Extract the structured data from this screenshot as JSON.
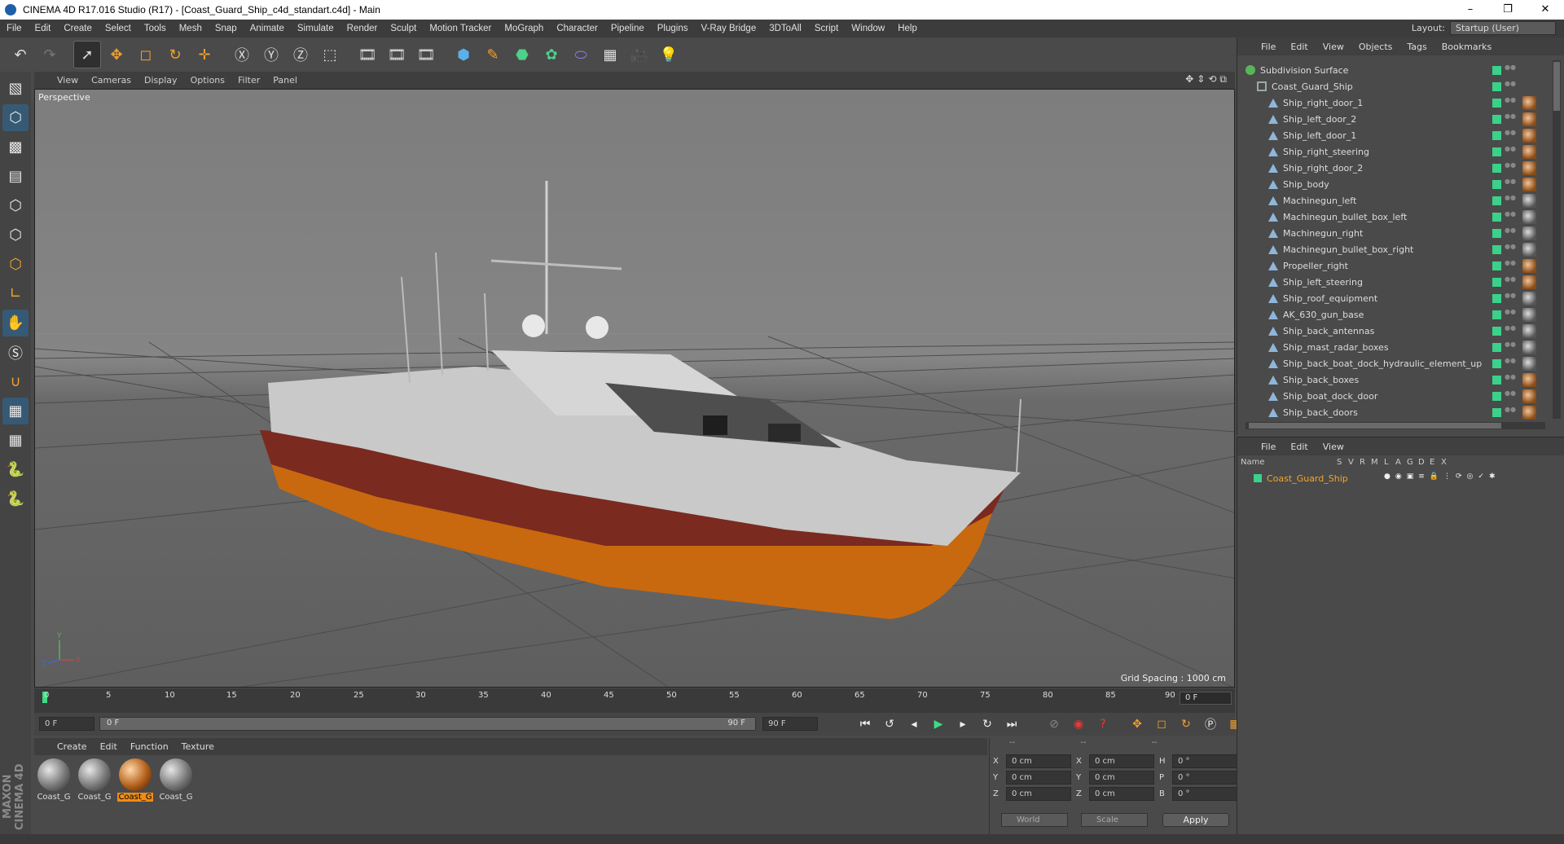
{
  "window": {
    "title": "CINEMA 4D R17.016 Studio (R17) - [Coast_Guard_Ship_c4d_standart.c4d] - Main",
    "controls": [
      "–",
      "❐",
      "✕"
    ]
  },
  "menubar": {
    "items": [
      "File",
      "Edit",
      "Create",
      "Select",
      "Tools",
      "Mesh",
      "Snap",
      "Animate",
      "Simulate",
      "Render",
      "Sculpt",
      "Motion Tracker",
      "MoGraph",
      "Character",
      "Pipeline",
      "Plugins",
      "V-Ray Bridge",
      "3DToAll",
      "Script",
      "Window",
      "Help"
    ],
    "layout_label": "Layout:",
    "layout_value": "Startup (User)"
  },
  "viewport": {
    "menu": [
      "View",
      "Cameras",
      "Display",
      "Options",
      "Filter",
      "Panel"
    ],
    "label": "Perspective",
    "grid_spacing": "Grid Spacing : 1000 cm",
    "axis_y": "Y",
    "axis_x": "X",
    "axis_z": "Z"
  },
  "timeline": {
    "ticks": [
      "0",
      "5",
      "10",
      "15",
      "20",
      "25",
      "30",
      "35",
      "40",
      "45",
      "50",
      "55",
      "60",
      "65",
      "70",
      "75",
      "80",
      "85",
      "90"
    ],
    "current_frame": "0 F"
  },
  "transport": {
    "start_field": "0 F",
    "slider_start": "0 F",
    "slider_end": "90 F",
    "end_field": "90 F"
  },
  "materials": {
    "menu": [
      "Create",
      "Edit",
      "Function",
      "Texture"
    ],
    "items": [
      {
        "name": "Coast_G",
        "style": "grey"
      },
      {
        "name": "Coast_G",
        "style": "grey"
      },
      {
        "name": "Coast_G",
        "style": "orange"
      },
      {
        "name": "Coast_G",
        "style": "grey"
      }
    ],
    "selected_index": 2
  },
  "coordinates": {
    "headers": [
      "--",
      "--",
      "--"
    ],
    "rows": [
      {
        "a1": "X",
        "v1": "0 cm",
        "a2": "X",
        "v2": "0 cm",
        "a3": "H",
        "v3": "0 °"
      },
      {
        "a1": "Y",
        "v1": "0 cm",
        "a2": "Y",
        "v2": "0 cm",
        "a3": "P",
        "v3": "0 °"
      },
      {
        "a1": "Z",
        "v1": "0 cm",
        "a2": "Z",
        "v2": "0 cm",
        "a3": "B",
        "v3": "0 °"
      }
    ],
    "mode1": "World",
    "mode2": "Scale",
    "apply_label": "Apply"
  },
  "object_manager": {
    "menu": [
      "File",
      "Edit",
      "View",
      "Objects",
      "Tags",
      "Bookmarks"
    ],
    "objects": [
      {
        "name": "Subdivision Surface",
        "level": 0,
        "type": "sub"
      },
      {
        "name": "Coast_Guard_Ship",
        "level": 1,
        "type": "null"
      },
      {
        "name": "Ship_right_door_1",
        "level": 2,
        "type": "poly",
        "tag": "o"
      },
      {
        "name": "Ship_left_door_2",
        "level": 2,
        "type": "poly",
        "tag": "o"
      },
      {
        "name": "Ship_left_door_1",
        "level": 2,
        "type": "poly",
        "tag": "o"
      },
      {
        "name": "Ship_right_steering",
        "level": 2,
        "type": "poly",
        "tag": "o"
      },
      {
        "name": "Ship_right_door_2",
        "level": 2,
        "type": "poly",
        "tag": "o"
      },
      {
        "name": "Ship_body",
        "level": 2,
        "type": "poly",
        "tag": "o"
      },
      {
        "name": "Machinegun_left",
        "level": 2,
        "type": "poly",
        "tag": "g"
      },
      {
        "name": "Machinegun_bullet_box_left",
        "level": 2,
        "type": "poly",
        "tag": "g"
      },
      {
        "name": "Machinegun_right",
        "level": 2,
        "type": "poly",
        "tag": "g"
      },
      {
        "name": "Machinegun_bullet_box_right",
        "level": 2,
        "type": "poly",
        "tag": "g"
      },
      {
        "name": "Propeller_right",
        "level": 2,
        "type": "poly",
        "tag": "o"
      },
      {
        "name": "Ship_left_steering",
        "level": 2,
        "type": "poly",
        "tag": "o"
      },
      {
        "name": "Ship_roof_equipment",
        "level": 2,
        "type": "poly",
        "tag": "g"
      },
      {
        "name": "AK_630_gun_base",
        "level": 2,
        "type": "poly",
        "tag": "g"
      },
      {
        "name": "Ship_back_antennas",
        "level": 2,
        "type": "poly",
        "tag": "g"
      },
      {
        "name": "Ship_mast_radar_boxes",
        "level": 2,
        "type": "poly",
        "tag": "g"
      },
      {
        "name": "Ship_back_boat_dock_hydraulic_element_up",
        "level": 2,
        "type": "poly",
        "tag": "g"
      },
      {
        "name": "Ship_back_boxes",
        "level": 2,
        "type": "poly",
        "tag": "o"
      },
      {
        "name": "Ship_boat_dock_door",
        "level": 2,
        "type": "poly",
        "tag": "o"
      },
      {
        "name": "Ship_back_doors",
        "level": 2,
        "type": "poly",
        "tag": "o"
      }
    ]
  },
  "layer_manager": {
    "menu": [
      "File",
      "Edit",
      "View"
    ],
    "columns": [
      "Name",
      "S",
      "V",
      "R",
      "M",
      "L",
      "A",
      "G",
      "D",
      "E",
      "X"
    ],
    "layers": [
      {
        "name": "Coast_Guard_Ship",
        "color": "#3bd18b"
      }
    ]
  },
  "branding": "MAXON CINEMA 4D"
}
